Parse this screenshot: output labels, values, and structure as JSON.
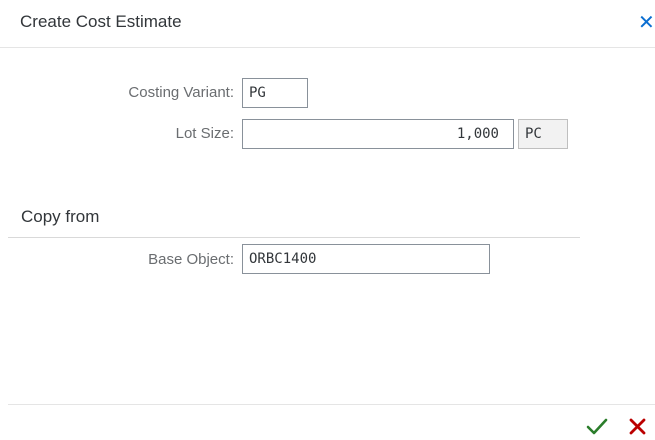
{
  "dialog": {
    "title": "Create Cost Estimate",
    "close_icon": "close-icon"
  },
  "form": {
    "costing_variant": {
      "label": "Costing Variant:",
      "value": "PG"
    },
    "lot_size": {
      "label": "Lot Size:",
      "value": "1,000",
      "unit": "PC"
    }
  },
  "copy_from": {
    "section_title": "Copy from",
    "base_object": {
      "label": "Base Object:",
      "value": "ORBC1400"
    }
  },
  "footer": {
    "confirm_icon": "checkmark-icon",
    "cancel_icon": "cancel-icon"
  },
  "colors": {
    "accent": "#0a6ed1",
    "confirm": "#2b7d2b",
    "cancel": "#bb0000"
  }
}
